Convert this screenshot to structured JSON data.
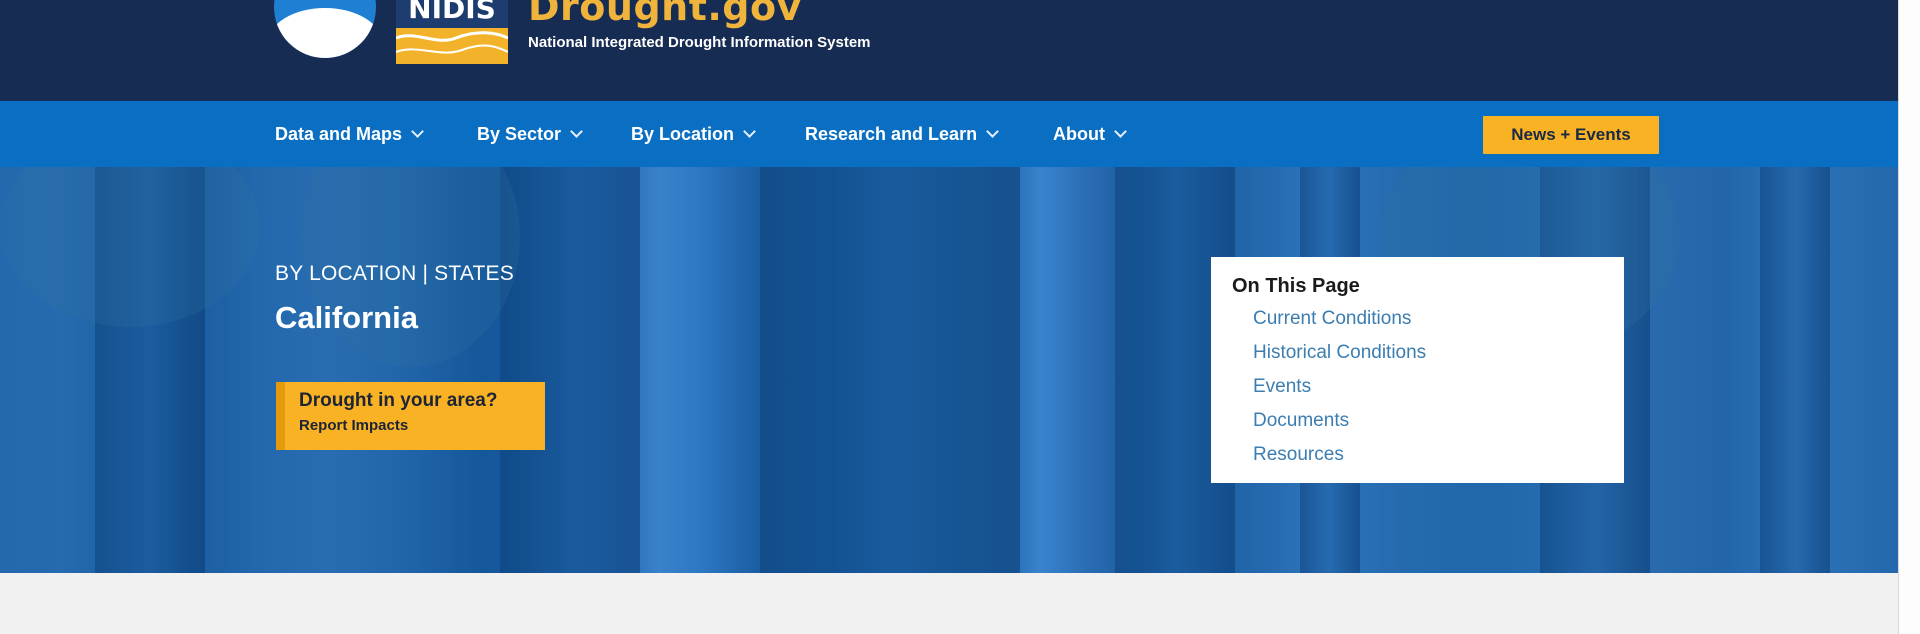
{
  "header": {
    "nidis_logo_text": "NIDIS",
    "site_title": "Drought.gov",
    "site_subtitle": "National Integrated Drought Information System"
  },
  "nav": {
    "items": [
      {
        "label": "Data and Maps"
      },
      {
        "label": "By Sector"
      },
      {
        "label": "By Location"
      },
      {
        "label": "Research and Learn"
      },
      {
        "label": "About"
      }
    ],
    "news_button": "News + Events"
  },
  "hero": {
    "breadcrumb": "BY LOCATION | STATES",
    "title": "California",
    "report": {
      "line1": "Drought in your area?",
      "line2": "Report Impacts"
    }
  },
  "on_this_page": {
    "title": "On This Page",
    "links": [
      {
        "label": "Current Conditions"
      },
      {
        "label": "Historical Conditions"
      },
      {
        "label": "Events"
      },
      {
        "label": "Documents"
      },
      {
        "label": "Resources"
      }
    ]
  },
  "colors": {
    "header_bg": "#172c52",
    "nav_bg": "#0a6fc2",
    "accent_yellow": "#f8b224",
    "title_gold": "#f0b43c",
    "link_blue": "#3c7db0"
  }
}
